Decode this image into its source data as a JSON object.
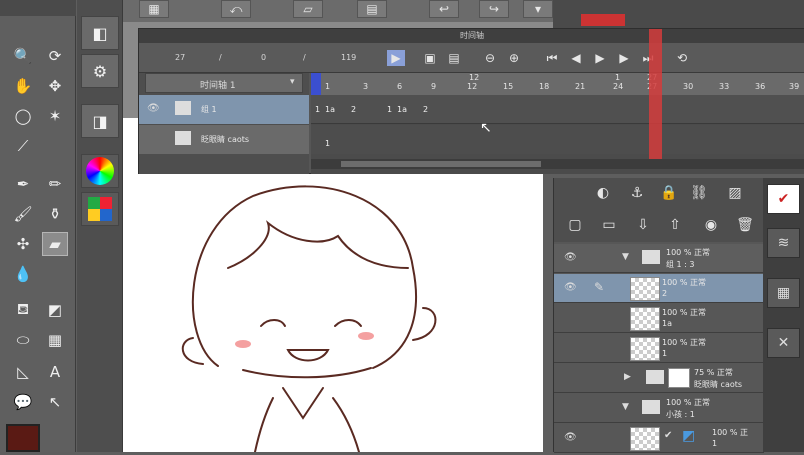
{
  "timeline": {
    "title": "时间轴",
    "current_frame": "27",
    "sep1": "/",
    "start_frame": "0",
    "sep2": "/",
    "end_frame": "119",
    "track_dropdown": "时间轴 1",
    "tracks": [
      {
        "name": "组 1"
      },
      {
        "name": "眨眼睛 caots"
      }
    ],
    "ruler_labels_top": [
      "12",
      "1",
      "27"
    ],
    "ruler_labels": [
      "1",
      "3",
      "6",
      "9",
      "12",
      "15",
      "18",
      "21",
      "24",
      "27",
      "30",
      "33",
      "36",
      "39"
    ],
    "track1_cels": [
      "1",
      "1a",
      "2",
      "1",
      "1a",
      "2"
    ],
    "track2_cels": [
      "1"
    ],
    "playhead_color": "#d43c3c"
  },
  "layers": [
    {
      "opacity": "100 %",
      "blend": "正常",
      "name": "组 1 : 3",
      "type": "folder"
    },
    {
      "opacity": "100 %",
      "blend": "正常",
      "name": "2",
      "type": "raster"
    },
    {
      "opacity": "100 %",
      "blend": "正常",
      "name": "1a",
      "type": "raster"
    },
    {
      "opacity": "100 %",
      "blend": "正常",
      "name": "1",
      "type": "raster"
    },
    {
      "opacity": "75 %",
      "blend": "正常",
      "name": "眨眼睛 caots",
      "type": "raster"
    },
    {
      "opacity": "100 %",
      "blend": "正常",
      "name": "小孩 : 1",
      "type": "folder"
    },
    {
      "opacity": "100 %",
      "blend": "正",
      "name": "1",
      "type": "vector"
    }
  ],
  "colors": {
    "main_color": "#5a1a14",
    "accent_red": "#d43c3c"
  },
  "icons": {
    "toolbox": [
      "zoom-icon",
      "rotate-icon",
      "hand-icon",
      "move-icon",
      "lasso-icon",
      "wand-icon",
      "eyedropper-icon",
      "pen-icon",
      "pencil-icon",
      "brush-icon",
      "airbrush-icon",
      "decoration-icon",
      "eraser-icon",
      "blend-icon",
      "fill-icon",
      "gradient-icon",
      "shape-icon",
      "frame-icon",
      "ruler-icon",
      "text-icon",
      "balloon-icon",
      "correct-line-icon"
    ]
  }
}
